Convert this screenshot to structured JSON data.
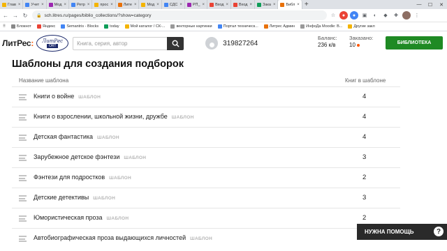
{
  "browser": {
    "tabs": [
      {
        "label": "Глав",
        "color": "#f4b400"
      },
      {
        "label": "Учет",
        "color": "#4285f4"
      },
      {
        "label": "Мод",
        "color": "#9c27b0"
      },
      {
        "label": "Ретр",
        "color": "#4285f4"
      },
      {
        "label": "прос",
        "color": "#f4b400"
      },
      {
        "label": "Лите",
        "color": "#e8710a"
      },
      {
        "label": "Мод",
        "color": "#f4b400"
      },
      {
        "label": "СДС",
        "color": "#4285f4"
      },
      {
        "label": "РП_",
        "color": "#9c27b0"
      },
      {
        "label": "Вход",
        "color": "#ea4335"
      },
      {
        "label": "Вход",
        "color": "#ea4335"
      },
      {
        "label": "Зака",
        "color": "#0f9d58"
      },
      {
        "label": "Библ",
        "color": "#e8710a",
        "active": true
      }
    ],
    "url": "sch.litres.ru/pages/biblio_collections/?show=category",
    "bookmarks": [
      {
        "label": "Блокнот",
        "color": "#888888"
      },
      {
        "label": "Яндекс",
        "color": "#ea4335"
      },
      {
        "label": "Semantris - Blocks",
        "color": "#4285f4"
      },
      {
        "label": "today",
        "color": "#0f9d58"
      },
      {
        "label": "Мой каталог / СК-...",
        "color": "#f4b400"
      },
      {
        "label": "векторные картинки",
        "color": "#999999"
      },
      {
        "label": "Портал техническ...",
        "color": "#4285f4"
      },
      {
        "label": "Литрес Админ",
        "color": "#e8710a"
      },
      {
        "label": "ИнфоДа Moodle: В...",
        "color": "#999999"
      },
      {
        "label": "Другие закл",
        "color": "#f4b400"
      }
    ]
  },
  "header": {
    "logo_text": "ЛитРес",
    "logo_colon": ":",
    "seal_top": "ЛитРес",
    "seal_bottom": "ОRT",
    "search_placeholder": "Книга, серия, автор",
    "user_id": "319827264",
    "balance_label": "Баланс:",
    "balance_value": "236 к/в",
    "ordered_label": "Заказано:",
    "ordered_value": "10",
    "library_button": "БИБЛИОТЕКА"
  },
  "main": {
    "title": "Шаблоны для создания подборок",
    "col_name": "Название шаблона",
    "col_count": "Книг в шаблоне",
    "tag": "ШАБЛОН",
    "rows": [
      {
        "name": "Книги о войне",
        "count": "4"
      },
      {
        "name": "Книги о взрослении, школьной жизни, дружбе",
        "count": "4"
      },
      {
        "name": "Детская фантастика",
        "count": "4"
      },
      {
        "name": "Зарубежное детское фэнтези",
        "count": "3"
      },
      {
        "name": "Фэнтези для подростков",
        "count": "2"
      },
      {
        "name": "Детские детективы",
        "count": "3"
      },
      {
        "name": "Юмористическая проза",
        "count": "2"
      },
      {
        "name": "Автобиографическая проза выдающихся личностей",
        "count": ""
      }
    ]
  },
  "help": {
    "label": "НУЖНА ПОМОЩЬ",
    "icon": "?"
  },
  "colors": {
    "accent": "#ff5500",
    "library_green": "#1f8a24",
    "help_bg": "#2a2a2a"
  }
}
